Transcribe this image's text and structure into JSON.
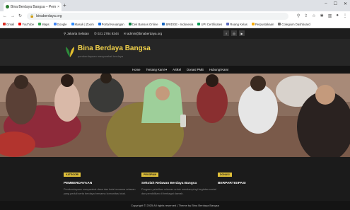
{
  "browser": {
    "tab_title": "Bina Berdaya Bangsa – Pemberda...",
    "tab_close": "×",
    "new_tab": "+",
    "window_controls": [
      "–",
      "☐",
      "✕"
    ],
    "url": "binaberdaya.org",
    "bookmarks": [
      {
        "label": "Gmail",
        "color": "#d93025"
      },
      {
        "label": "YouTube",
        "color": "#ff0000"
      },
      {
        "label": "Maps",
        "color": "#34a853"
      },
      {
        "label": "Google",
        "color": "#4285f4"
      },
      {
        "label": "Masuk | Zoom",
        "color": "#2d8cff"
      },
      {
        "label": "Portal Keuangan",
        "color": "#1a73e8"
      },
      {
        "label": "Cek Bansos Online",
        "color": "#0b8043"
      },
      {
        "label": "BRIDGE - Indonesia",
        "color": "#1565c0"
      },
      {
        "label": "UPI Certificates",
        "color": "#0f9d58"
      },
      {
        "label": "Ruang Kelas",
        "color": "#5c6bc0"
      },
      {
        "label": "Perpustakaan",
        "color": "#f9ab00"
      },
      {
        "label": "Colegium Dashboard",
        "color": "#757575"
      }
    ]
  },
  "topbar": {
    "address": "Jakarta Selatan",
    "phone": "021 2784 8344",
    "email": "admin@binaberdaya.org",
    "social": [
      "f",
      "◎",
      "▶"
    ]
  },
  "site": {
    "name": "Bina Berdaya Bangsa",
    "tagline": "pemberdayaan masyarakat berdaya",
    "logo_colors": {
      "left": "#2e8b3a",
      "right": "#e2c02e"
    }
  },
  "nav": [
    "Home",
    "Tentang Kami ▾",
    "Artikel",
    "Donasi PMB",
    "Hubungi Kami"
  ],
  "cards": [
    {
      "badge": "KATEGORI",
      "title": "PEMBERDAYAAN",
      "text": "Pemberdayaan masyarakat desa dan kota bersama relawan yang peduli serta berdaya bersama komunitas lokal."
    },
    {
      "badge": "PROGRAM",
      "title": "Sekolah Relawan Berdaya Bangsa",
      "text": "Program pelatihan relawan untuk mendampingi kegiatan sosial dan pendidikan di berbagai daerah."
    },
    {
      "badge": "DONASI",
      "title": "BERPARTISIPASI",
      "text": ""
    }
  ],
  "footer": "Copyright © 2025 All rights reserved | Theme by Bina Berdaya Bangsa",
  "colors": {
    "accent": "#e0c03a",
    "dark": "#1b1b1b"
  }
}
